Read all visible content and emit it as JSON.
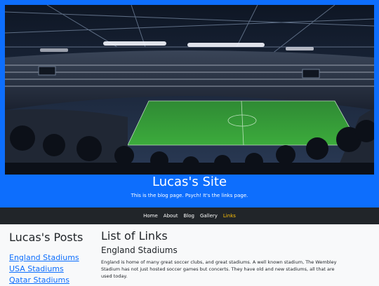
{
  "header": {
    "title": "Lucas's Site",
    "subtitle": "This is the blog page. Psych! It's the links page."
  },
  "nav": {
    "items": [
      "Home",
      "About",
      "Blog",
      "Gallery",
      "Links"
    ],
    "active": "Links",
    "active_color": "#ffc107"
  },
  "sidebar": {
    "title": "Lucas's Posts",
    "links": [
      "England Stadiums",
      "USA Stadiums",
      "Qatar Stadiums"
    ]
  },
  "main": {
    "title": "List of Links",
    "section_title": "England Stadiums",
    "section_text": "England is home of many great soccer clubs, and great stadiums. A well known stadium, The Wembley Stadium has not just hosted soccer games but concerts. They have old and new stadiums, all that are used today."
  },
  "colors": {
    "brand_blue": "#0d6efd",
    "navbar_bg": "#212529",
    "link_color": "#0d6efd"
  }
}
